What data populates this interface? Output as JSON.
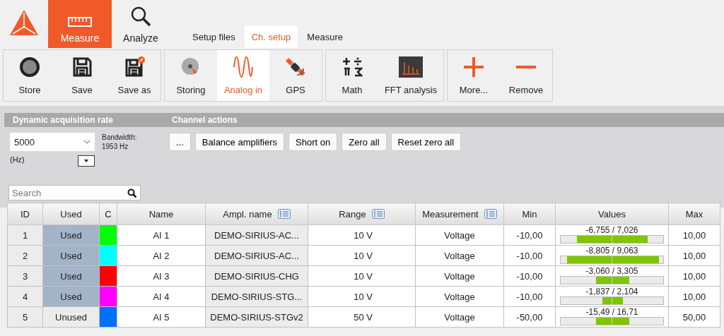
{
  "main_tabs": [
    {
      "label": "Measure",
      "selected": true
    },
    {
      "label": "Analyze",
      "selected": false
    }
  ],
  "sub_tabs": [
    {
      "label": "Setup files",
      "selected": false
    },
    {
      "label": "Ch. setup",
      "selected": true
    },
    {
      "label": "Measure",
      "selected": false
    }
  ],
  "toolbar_groups": [
    {
      "buttons": [
        {
          "label": "Store",
          "selected": false
        },
        {
          "label": "Save",
          "selected": false
        },
        {
          "label": "Save as",
          "selected": false
        }
      ]
    },
    {
      "buttons": [
        {
          "label": "Storing",
          "selected": false
        },
        {
          "label": "Analog in",
          "selected": true
        },
        {
          "label": "GPS",
          "selected": false
        }
      ]
    },
    {
      "buttons": [
        {
          "label": "Math",
          "selected": false
        },
        {
          "label": "FFT analysis",
          "selected": false
        }
      ]
    },
    {
      "buttons": [
        {
          "label": "More...",
          "selected": false
        },
        {
          "label": "Remove",
          "selected": false
        }
      ]
    }
  ],
  "acquisition": {
    "title": "Dynamic acquisition rate",
    "rate": "5000",
    "unit": "(Hz)",
    "bandwidth_label": "Bandwidth:",
    "bandwidth_value": "1953 Hz"
  },
  "channel_actions": {
    "title": "Channel actions",
    "buttons": [
      "...",
      "Balance amplifiers",
      "Short on",
      "Zero all",
      "Reset zero all"
    ]
  },
  "search": {
    "placeholder": "Search"
  },
  "table": {
    "columns": [
      {
        "label": "ID",
        "menu": false
      },
      {
        "label": "Used",
        "menu": false
      },
      {
        "label": "C",
        "menu": false
      },
      {
        "label": "Name",
        "menu": false
      },
      {
        "label": "Ampl. name",
        "menu": true
      },
      {
        "label": "Range",
        "menu": true
      },
      {
        "label": "Measurement",
        "menu": true
      },
      {
        "label": "Min",
        "menu": false
      },
      {
        "label": "Values",
        "menu": false
      },
      {
        "label": "Max",
        "menu": false
      }
    ],
    "rows": [
      {
        "id": "1",
        "used": true,
        "used_label": "Used",
        "color": "#00ff00",
        "name": "AI 1",
        "ampl_name": "DEMO-SIRIUS-AC...",
        "range": "10 V",
        "measurement": "Voltage",
        "min": "-10,00",
        "values": "-6,755 / 7,026",
        "bar": {
          "negative": {
            "level": 0.68
          },
          "positive": {
            "level": 0.7
          }
        },
        "max": "10,00"
      },
      {
        "id": "2",
        "used": true,
        "used_label": "Used",
        "color": "#00ffff",
        "name": "AI 2",
        "ampl_name": "DEMO-SIRIUS-AC...",
        "range": "10 V",
        "measurement": "Voltage",
        "min": "-10,00",
        "values": "-8,805 / 9,063",
        "bar": {
          "negative": {
            "level": 0.88
          },
          "positive": {
            "level": 0.91
          }
        },
        "max": "10,00"
      },
      {
        "id": "3",
        "used": true,
        "used_label": "Used",
        "color": "#ff0000",
        "name": "AI 3",
        "ampl_name": "DEMO-SIRIUS-CHG",
        "range": "10 V",
        "measurement": "Voltage",
        "min": "-10,00",
        "values": "-3,060 / 3,305",
        "bar": {
          "negative": {
            "level": 0.31
          },
          "positive": {
            "level": 0.33
          }
        },
        "max": "10,00"
      },
      {
        "id": "4",
        "used": true,
        "used_label": "Used",
        "color": "#ff00ff",
        "name": "AI 4",
        "ampl_name": "DEMO-SIRIUS-STG...",
        "range": "10 V",
        "measurement": "Voltage",
        "min": "-10,00",
        "values": "-1,837 / 2,104",
        "bar": {
          "negative": {
            "level": 0.18
          },
          "positive": {
            "level": 0.21
          }
        },
        "max": "10,00"
      },
      {
        "id": "5",
        "used": false,
        "used_label": "Unused",
        "color": "#0070ff",
        "name": "AI 5",
        "ampl_name": "DEMO-SIRIUS-STGv2",
        "range": "50 V",
        "measurement": "Voltage",
        "min": "-50,00",
        "values": "-15,49 / 16,71",
        "bar": {
          "negative": {
            "level": 0.31
          },
          "positive": {
            "level": 0.33
          }
        },
        "max": "50,00"
      }
    ]
  }
}
